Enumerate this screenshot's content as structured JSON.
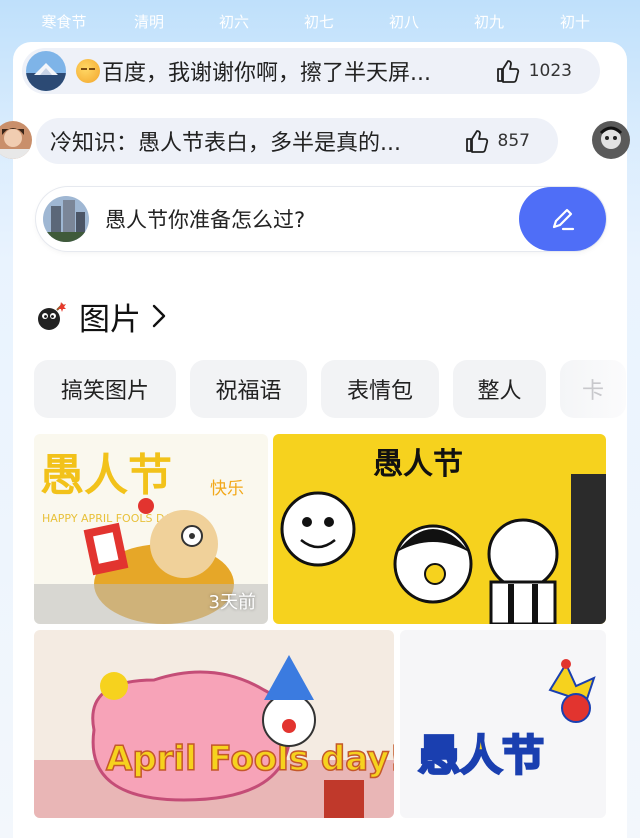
{
  "festival_bar": {
    "items": [
      "寒食节",
      "清明",
      "初六",
      "初七",
      "初八",
      "初九",
      "初十"
    ]
  },
  "comments": [
    {
      "text": "百度，我谢谢你啊，擦了半天屏...",
      "likes": "1023"
    },
    {
      "text": "冷知识：愚人节表白，多半是真的...",
      "likes": "857"
    }
  ],
  "ask": {
    "question": "愚人节你准备怎么过?"
  },
  "images_section": {
    "title": "图片",
    "chips": [
      "搞笑图片",
      "祝福语",
      "表情包",
      "整人",
      "卡"
    ],
    "images": [
      {
        "title": "愚人节",
        "subtitle": "快乐",
        "caption": "HAPPY APRIL FOOLS DAY",
        "badge": "3天前"
      },
      {
        "title": "愚人节"
      },
      {
        "title": "April Fools day!"
      },
      {
        "title": "愚人节"
      }
    ]
  },
  "colors": {
    "accent": "#4f6ef7",
    "comment_bg": "#eef1f8",
    "yellow": "#f6d21e"
  }
}
